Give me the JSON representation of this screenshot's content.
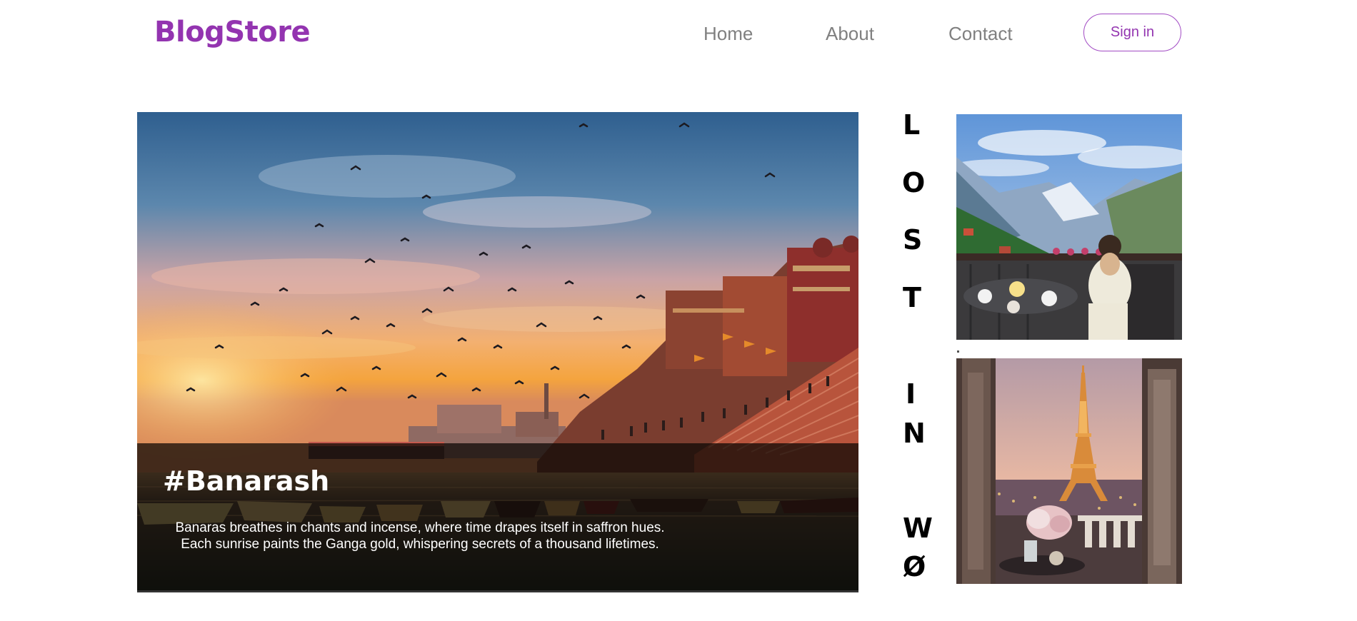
{
  "header": {
    "brand": "BlogStore",
    "nav": [
      "Home",
      "About",
      "Contact"
    ],
    "signin_label": "Sign in"
  },
  "hero": {
    "title": "#Banarash",
    "description_line1": "Banaras breathes in chants and incense, where time drapes itself in saffron hues.",
    "description_line2": "Each sunrise paints the Ganga gold, whispering secrets of a thousand lifetimes.",
    "image": "varanasi-ghats-sunset-photo"
  },
  "side": {
    "letters": [
      "L",
      "O",
      "S",
      "T",
      "I",
      "N",
      "W",
      "Ø"
    ],
    "images": [
      "alps-balcony-breakfast-photo",
      "eiffel-tower-window-photo"
    ]
  },
  "colors": {
    "brand": "#9334b0",
    "nav": "#808080",
    "overlay": "#080503"
  }
}
